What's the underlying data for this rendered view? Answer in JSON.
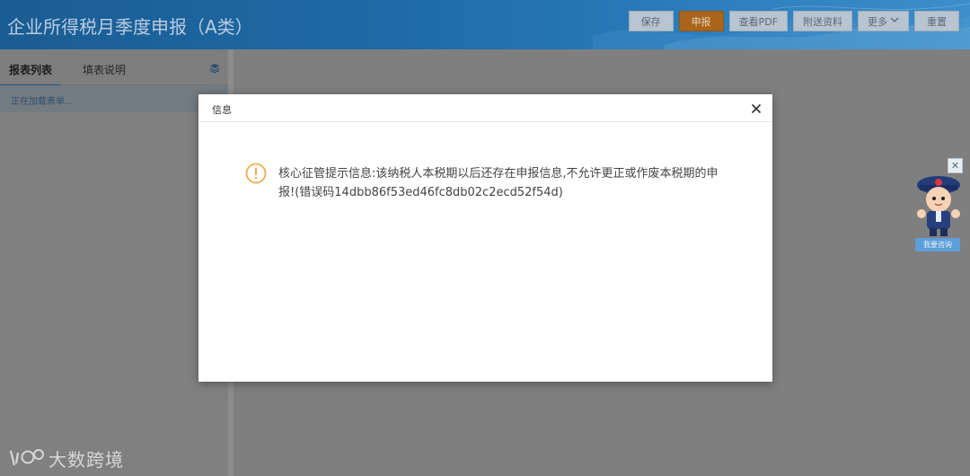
{
  "header": {
    "title": "企业所得税月季度申报（A类）",
    "buttons": [
      {
        "label": "保存"
      },
      {
        "label": "申报"
      },
      {
        "label": "查看PDF"
      },
      {
        "label": "附送资料"
      },
      {
        "label": "更多"
      },
      {
        "label": "重置"
      }
    ]
  },
  "left_panel": {
    "tabs": [
      {
        "label": "报表列表"
      },
      {
        "label": "填表说明"
      }
    ],
    "loading_text": "正在加载表单..."
  },
  "dialog": {
    "title": "信息",
    "message": "核心征管提示信息:该纳税人本税期以后还存在申报信息,不允许更正或作废本税期的申报!(错误码14dbb86f53ed46fc8db02c2ecd52f54d)"
  },
  "assistant": {
    "button_label": "我要咨询"
  },
  "watermark": {
    "text": "大数跨境"
  },
  "colors": {
    "header": "#1f6aa6",
    "primary_button": "#a9651a",
    "warning_icon": "#f0ad4e"
  },
  "icons": {
    "close": "close-icon",
    "warning": "warning-icon",
    "layers": "layers-icon",
    "dropdown": "chevron-down-icon"
  }
}
